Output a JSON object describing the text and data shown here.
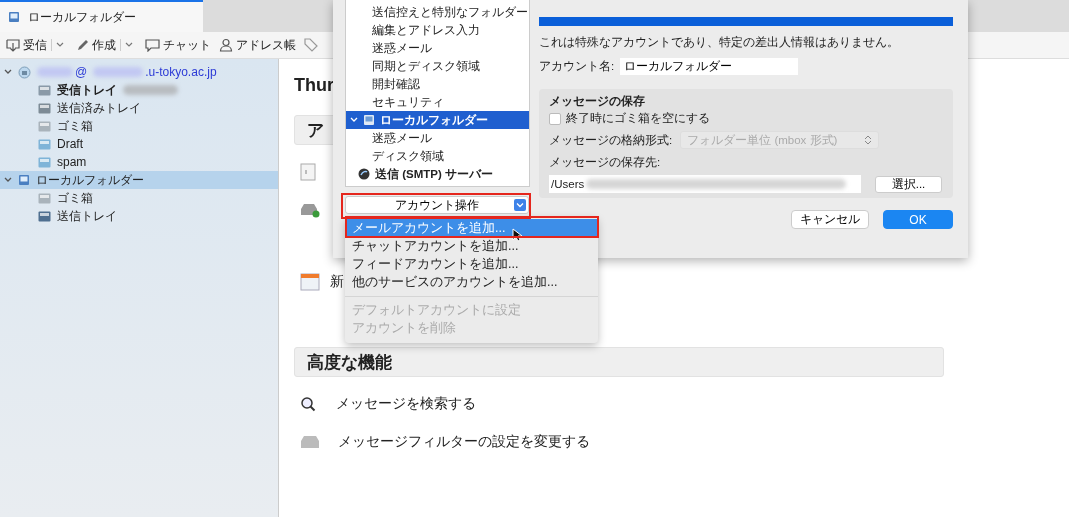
{
  "tabs": [
    {
      "label": "ローカルフォルダー",
      "selected": true
    }
  ],
  "toolbar": [
    {
      "kind": "get",
      "label": "受信",
      "dropdown": true
    },
    {
      "kind": "write",
      "label": "作成",
      "dropdown": true
    },
    {
      "kind": "chat",
      "label": "チャット",
      "dropdown": false
    },
    {
      "kind": "address",
      "label": "アドレス帳",
      "dropdown": false
    },
    {
      "kind": "tag",
      "dropdown": false
    }
  ],
  "sidebar": {
    "accounts": [
      {
        "kind": "mail",
        "label_before": "@",
        "label_after": ".u-tokyo.ac.jp",
        "expanded": true,
        "selected": false,
        "children": [
          {
            "kind": "inbox",
            "label": "受信トレイ",
            "bold": true,
            "selected": false
          },
          {
            "kind": "sent",
            "label": "送信済みトレイ",
            "bold": false,
            "selected": false
          },
          {
            "kind": "trash",
            "label": "ゴミ箱",
            "bold": false,
            "selected": false
          },
          {
            "kind": "folder",
            "label": "Draft",
            "bold": false,
            "selected": false
          },
          {
            "kind": "folder",
            "label": "spam",
            "bold": false,
            "selected": false
          }
        ]
      },
      {
        "kind": "local",
        "label": "ローカルフォルダー",
        "expanded": true,
        "selected": true,
        "children": [
          {
            "kind": "trash",
            "label": "ゴミ箱",
            "bold": false,
            "selected": false
          },
          {
            "kind": "outbox",
            "label": "送信トレイ",
            "bold": false,
            "selected": false
          }
        ]
      }
    ]
  },
  "content": {
    "title": "Thur",
    "sections": [
      {
        "title": "ア",
        "rows": [
          {
            "kind": "settings"
          },
          {
            "kind": "add-account"
          },
          {
            "kind": "calendar",
            "label": "新"
          }
        ]
      },
      {
        "title": "高度な機能",
        "rows": [
          {
            "kind": "search",
            "label": "メッセージを検索する"
          },
          {
            "kind": "filter",
            "label": "メッセージフィルターの設定を変更する"
          }
        ]
      }
    ]
  },
  "dialog": {
    "tree": [
      {
        "kind": "page",
        "label": "送信控えと特別なフォルダー",
        "selected": false
      },
      {
        "kind": "page",
        "label": "編集とアドレス入力",
        "selected": false
      },
      {
        "kind": "page",
        "label": "迷惑メール",
        "selected": false
      },
      {
        "kind": "page",
        "label": "同期とディスク領域",
        "selected": false
      },
      {
        "kind": "page",
        "label": "開封確認",
        "selected": false
      },
      {
        "kind": "page",
        "label": "セキュリティ",
        "selected": false
      },
      {
        "kind": "account",
        "label": "ローカルフォルダー",
        "selected": true,
        "expanded": true,
        "children": [
          {
            "kind": "page",
            "label": "迷惑メール",
            "selected": false
          },
          {
            "kind": "page",
            "label": "ディスク領域",
            "selected": false
          }
        ]
      },
      {
        "kind": "server",
        "label": "送信 (SMTP) サーバー",
        "selected": false
      }
    ],
    "account_actions": "アカウント操作",
    "description": "これは特殊なアカウントであり、特定の差出人情報はありません。",
    "account_name_label": "アカウント名:",
    "account_name": "ローカルフォルダー",
    "storage": {
      "title": "メッセージの保存",
      "empty_trash": {
        "label": "終了時にゴミ箱を空にする",
        "checked": false
      },
      "format_label": "メッセージの格納形式:",
      "format": {
        "value": "フォルダー単位 (mbox 形式)",
        "disabled": true
      },
      "path_label": "メッセージの保存先:",
      "path": "/Users",
      "browse": "選択..."
    },
    "buttons": [
      {
        "label": "キャンセル",
        "kind": "cancel"
      },
      {
        "label": "OK",
        "kind": "default"
      }
    ]
  },
  "menu": [
    {
      "label": "メールアカウントを追加...",
      "selected": true,
      "disabled": false,
      "separator_before": false
    },
    {
      "label": "チャットアカウントを追加...",
      "selected": false,
      "disabled": false,
      "separator_before": false
    },
    {
      "label": "フィードアカウントを追加...",
      "selected": false,
      "disabled": false,
      "separator_before": false
    },
    {
      "label": "他のサービスのアカウントを追加...",
      "selected": false,
      "disabled": false,
      "separator_before": false
    },
    {
      "label": "デフォルトアカウントに設定",
      "selected": false,
      "disabled": true,
      "separator_before": true
    },
    {
      "label": "アカウントを削除",
      "selected": false,
      "disabled": true,
      "separator_before": false
    }
  ]
}
